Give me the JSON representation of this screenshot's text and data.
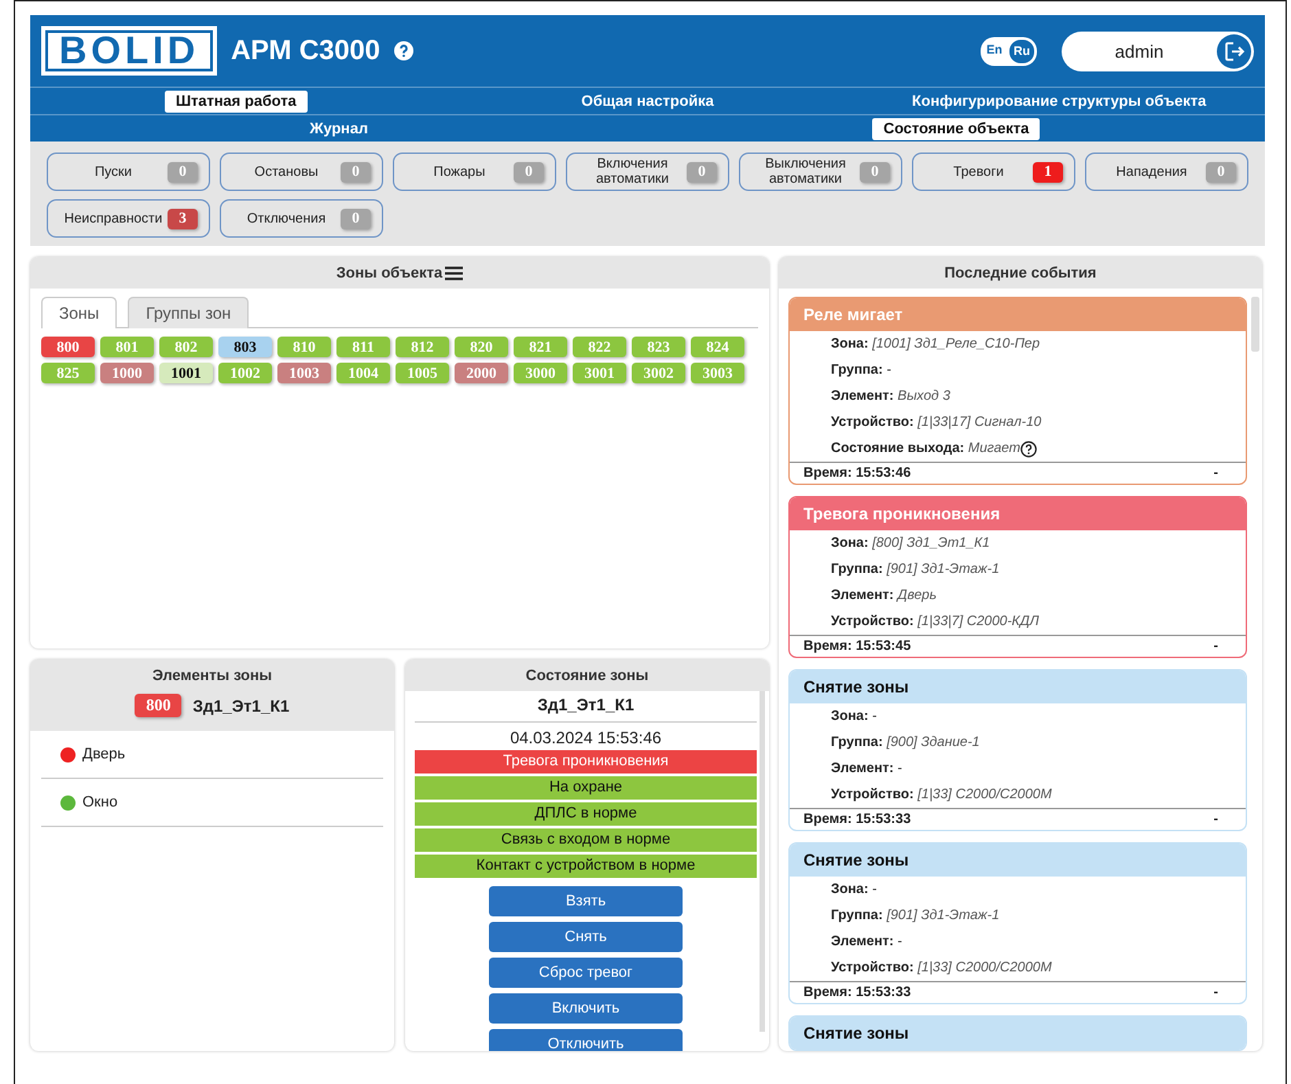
{
  "header": {
    "logo": "BOLID",
    "title": "АРМ С3000",
    "languages": [
      {
        "label": "En",
        "selected": false
      },
      {
        "label": "Ru",
        "selected": true
      }
    ],
    "user": "admin"
  },
  "nav_primary": [
    {
      "label": "Штатная работа",
      "selected": true
    },
    {
      "label": "Общая настройка",
      "selected": false
    },
    {
      "label": "Конфигурирование структуры объекта",
      "selected": false
    }
  ],
  "nav_secondary": [
    {
      "label": "Журнал",
      "selected": false
    },
    {
      "label": "Состояние объекта",
      "selected": true
    }
  ],
  "counters": [
    {
      "label": "Пуски",
      "count": "0",
      "color": "#a5a5a5"
    },
    {
      "label": "Остановы",
      "count": "0",
      "color": "#a5a5a5"
    },
    {
      "label": "Пожары",
      "count": "0",
      "color": "#a5a5a5"
    },
    {
      "label": "Включения автоматики",
      "count": "0",
      "color": "#a5a5a5"
    },
    {
      "label": "Выключения автоматики",
      "count": "0",
      "color": "#a5a5a5"
    },
    {
      "label": "Тревоги",
      "count": "1",
      "color": "#ee1c1c"
    },
    {
      "label": "Нападения",
      "count": "0",
      "color": "#a5a5a5"
    },
    {
      "label": "Неисправности",
      "count": "3",
      "color": "#c84848"
    },
    {
      "label": "Отключения",
      "count": "0",
      "color": "#a5a5a5"
    }
  ],
  "zones_panel": {
    "title": "Зоны объекта",
    "tabs": [
      {
        "label": "Зоны",
        "selected": true
      },
      {
        "label": "Группы зон",
        "selected": false
      }
    ],
    "zones": [
      {
        "number": "800",
        "color": "#e84545"
      },
      {
        "number": "801",
        "color": "#8cc63f"
      },
      {
        "number": "802",
        "color": "#8cc63f"
      },
      {
        "number": "803",
        "color": "#a8d2ef"
      },
      {
        "number": "810",
        "color": "#8cc63f"
      },
      {
        "number": "811",
        "color": "#8cc63f"
      },
      {
        "number": "812",
        "color": "#8cc63f"
      },
      {
        "number": "820",
        "color": "#8cc63f"
      },
      {
        "number": "821",
        "color": "#8cc63f"
      },
      {
        "number": "822",
        "color": "#8cc63f"
      },
      {
        "number": "823",
        "color": "#8cc63f"
      },
      {
        "number": "824",
        "color": "#8cc63f"
      },
      {
        "number": "825",
        "color": "#8cc63f"
      },
      {
        "number": "1000",
        "color": "#c98080"
      },
      {
        "number": "1001",
        "color": "#d6eabc"
      },
      {
        "number": "1002",
        "color": "#8cc63f"
      },
      {
        "number": "1003",
        "color": "#c98080"
      },
      {
        "number": "1004",
        "color": "#8cc63f"
      },
      {
        "number": "1005",
        "color": "#8cc63f"
      },
      {
        "number": "2000",
        "color": "#c98080"
      },
      {
        "number": "3000",
        "color": "#8cc63f"
      },
      {
        "number": "3001",
        "color": "#8cc63f"
      },
      {
        "number": "3002",
        "color": "#8cc63f"
      },
      {
        "number": "3003",
        "color": "#8cc63f"
      }
    ]
  },
  "zone_elements": {
    "title": "Элементы зоны",
    "zone_number": "800",
    "zone_name": "Зд1_Эт1_К1",
    "elements": [
      {
        "name": "Дверь",
        "color": "#ee2222"
      },
      {
        "name": "Окно",
        "color": "#5cb83c"
      }
    ]
  },
  "zone_state": {
    "title": "Состояние зоны",
    "zone_name": "Зд1_Эт1_К1",
    "datetime": "04.03.2024 15:53:46",
    "statuses": [
      {
        "text": "Тревога проникновения",
        "color": "#ec4444"
      },
      {
        "text": "На охране",
        "color": "#8dc63f"
      },
      {
        "text": "ДПЛС в норме",
        "color": "#8dc63f"
      },
      {
        "text": "Связь с входом в норме",
        "color": "#8dc63f"
      },
      {
        "text": "Контакт с устройством в норме",
        "color": "#8dc63f"
      }
    ],
    "buttons": [
      "Взять",
      "Снять",
      "Сброс тревог",
      "Включить",
      "Отключить"
    ]
  },
  "events_panel": {
    "title": "Последние события",
    "events": [
      {
        "title": "Реле мигает",
        "color": "#e99a72",
        "fields": [
          {
            "text": "**Зона:** *[1001] Зд1_Реле_С10-Пер*"
          },
          {
            "text": "**Группа:** -"
          },
          {
            "text": "**Элемент:** *Выход 3*"
          },
          {
            "text": "**Устройство:** *[1|33|17] Сигнал-10*"
          },
          {
            "text": "**Состояние выхода:** *Мигает*",
            "help": true
          }
        ],
        "time": "Время: 15:53:46",
        "mark": "-"
      },
      {
        "title": "Тревога проникновения",
        "color": "#ef6b78",
        "fields": [
          {
            "text": "**Зона:** *[800] Зд1_Эт1_К1*"
          },
          {
            "text": "**Группа:** *[901] Зд1-Этаж-1*"
          },
          {
            "text": "**Элемент:** *Дверь*"
          },
          {
            "text": "**Устройство:** *[1|33|7] С2000-КДЛ*"
          }
        ],
        "time": "Время: 15:53:45",
        "mark": "-"
      },
      {
        "title": "Снятие зоны",
        "color": "#c4e1f5",
        "fields": [
          {
            "text": "**Зона:** -"
          },
          {
            "text": "**Группа:** *[900] Здание-1*"
          },
          {
            "text": "**Элемент:** -"
          },
          {
            "text": "**Устройство:** *[1|33] С2000/С2000М*"
          }
        ],
        "time": "Время: 15:53:33",
        "mark": "-"
      },
      {
        "title": "Снятие зоны",
        "color": "#c4e1f5",
        "fields": [
          {
            "text": "**Зона:** -"
          },
          {
            "text": "**Группа:** *[901] Зд1-Этаж-1*"
          },
          {
            "text": "**Элемент:** -"
          },
          {
            "text": "**Устройство:** *[1|33] С2000/С2000М*"
          }
        ],
        "time": "Время: 15:53:33",
        "mark": "-"
      },
      {
        "title": "Снятие зоны",
        "color": "#c4e1f5"
      }
    ]
  }
}
